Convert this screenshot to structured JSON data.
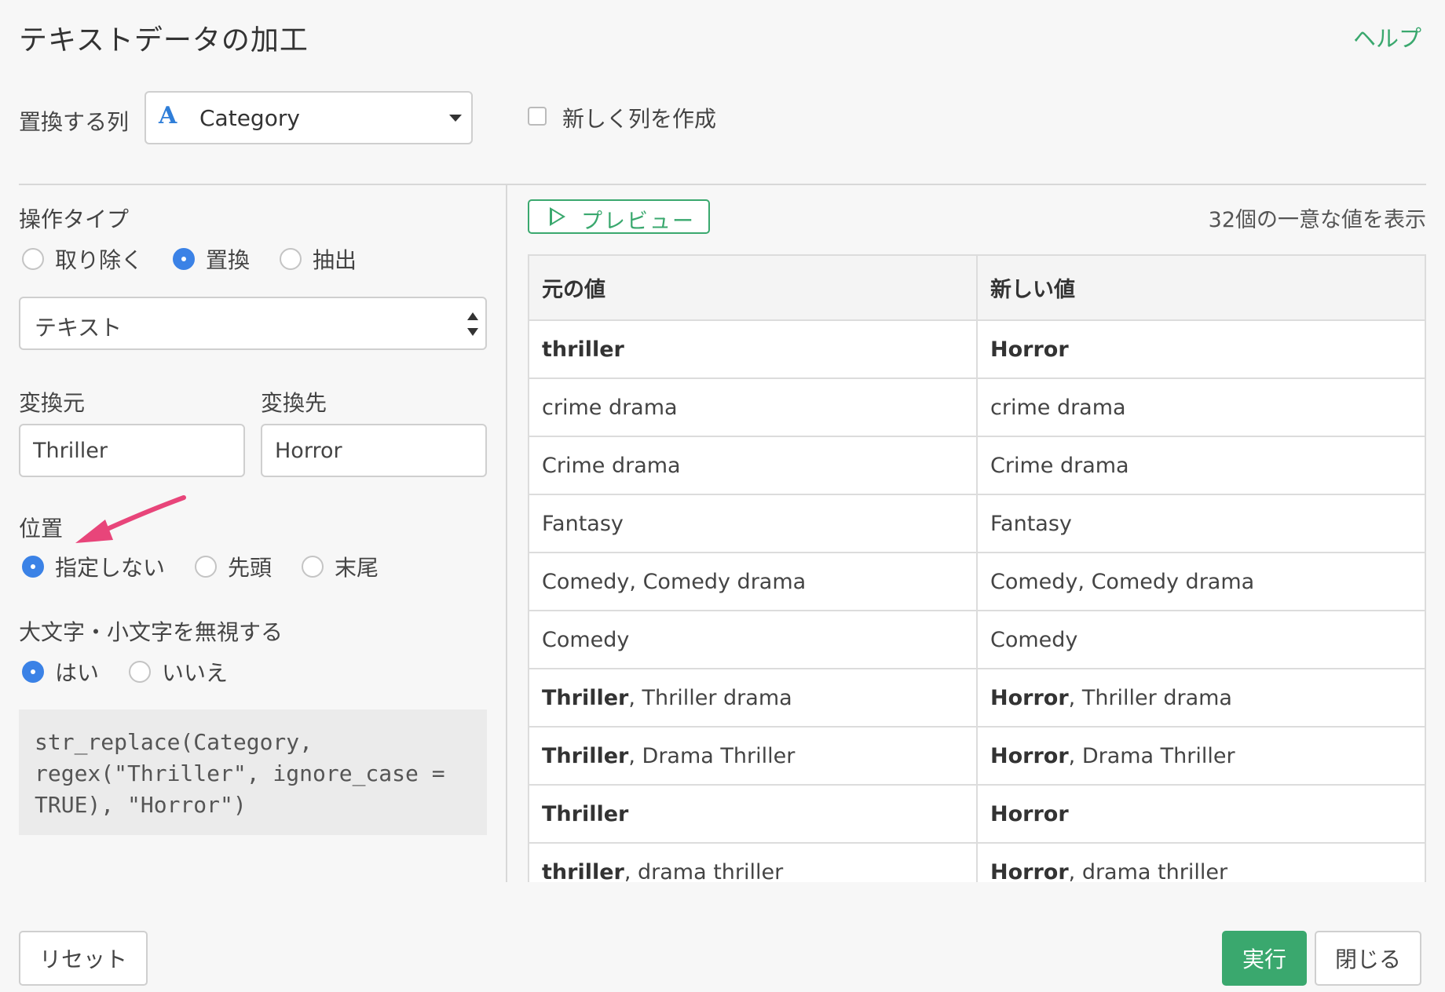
{
  "header": {
    "title": "テキストデータの加工",
    "help": "ヘルプ"
  },
  "column_select": {
    "label": "置換する列",
    "type_icon": "A",
    "value": "Category"
  },
  "new_column": {
    "label": "新しく列を作成",
    "checked": false
  },
  "operation": {
    "label": "操作タイプ",
    "options": [
      "取り除く",
      "置換",
      "抽出"
    ],
    "selected": "置換"
  },
  "text_type": {
    "value": "テキスト"
  },
  "from": {
    "label": "変換元",
    "value": "Thriller"
  },
  "to": {
    "label": "変換先",
    "value": "Horror"
  },
  "position": {
    "label": "位置",
    "options": [
      "指定しない",
      "先頭",
      "末尾"
    ],
    "selected": "指定しない"
  },
  "ignore_case": {
    "label": "大文字・小文字を無視する",
    "options": [
      "はい",
      "いいえ"
    ],
    "selected": "はい"
  },
  "code": "str_replace(Category,\nregex(\"Thriller\", ignore_case =\nTRUE), \"Horror\")",
  "preview": {
    "button": "プレビュー",
    "count_text": "32個の一意な値を表示"
  },
  "table": {
    "headers": [
      "元の値",
      "新しい値"
    ],
    "rows": [
      [
        {
          "b": "thriller",
          "r": ""
        },
        {
          "b": "Horror",
          "r": ""
        }
      ],
      [
        {
          "b": "",
          "r": "crime drama"
        },
        {
          "b": "",
          "r": "crime drama"
        }
      ],
      [
        {
          "b": "",
          "r": "Crime drama"
        },
        {
          "b": "",
          "r": "Crime drama"
        }
      ],
      [
        {
          "b": "",
          "r": "Fantasy"
        },
        {
          "b": "",
          "r": "Fantasy"
        }
      ],
      [
        {
          "b": "",
          "r": "Comedy, Comedy drama"
        },
        {
          "b": "",
          "r": "Comedy, Comedy drama"
        }
      ],
      [
        {
          "b": "",
          "r": "Comedy"
        },
        {
          "b": "",
          "r": "Comedy"
        }
      ],
      [
        {
          "b": "Thriller",
          "r": ", Thriller drama"
        },
        {
          "b": "Horror",
          "r": ", Thriller drama"
        }
      ],
      [
        {
          "b": "Thriller",
          "r": ", Drama Thriller"
        },
        {
          "b": "Horror",
          "r": ", Drama Thriller"
        }
      ],
      [
        {
          "b": "Thriller",
          "r": ""
        },
        {
          "b": "Horror",
          "r": ""
        }
      ],
      [
        {
          "b": "thriller",
          "r": ", drama thriller"
        },
        {
          "b": "Horror",
          "r": ", drama thriller"
        }
      ]
    ]
  },
  "footer": {
    "reset": "リセット",
    "run": "実行",
    "close": "閉じる"
  },
  "colors": {
    "accent_green": "#3aa86e",
    "radio_blue": "#3b82e6",
    "arrow_pink": "#e8457a"
  }
}
